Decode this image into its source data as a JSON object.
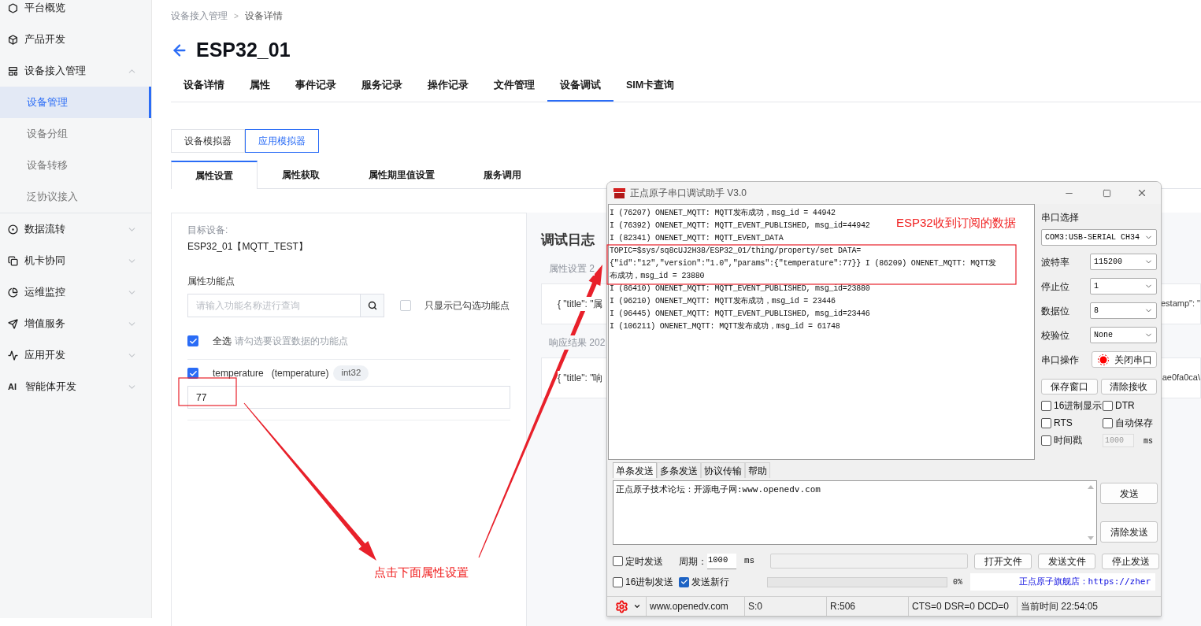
{
  "sidebar": {
    "items": [
      {
        "kind": "link",
        "label": "平台概览"
      },
      {
        "kind": "link",
        "label": "产品开发"
      },
      {
        "kind": "group",
        "label": "设备接入管理",
        "expanded": true,
        "children": [
          {
            "label": "设备管理",
            "selected": true
          },
          {
            "label": "设备分组",
            "selected": false
          },
          {
            "label": "设备转移",
            "selected": false
          },
          {
            "label": "泛协议接入",
            "selected": false
          }
        ]
      },
      {
        "kind": "group",
        "label": "数据流转",
        "expanded": false
      },
      {
        "kind": "group",
        "label": "机卡协同",
        "expanded": false
      },
      {
        "kind": "group",
        "label": "运维监控",
        "expanded": false
      },
      {
        "kind": "group",
        "label": "增值服务",
        "expanded": false
      },
      {
        "kind": "group",
        "label": "应用开发",
        "expanded": false
      },
      {
        "kind": "group",
        "label": "智能体开发",
        "expanded": false,
        "icon_text": "AI"
      }
    ]
  },
  "breadcrumb": [
    "设备接入管理",
    "设备详情"
  ],
  "breadcrumb_separator": ">",
  "title": "ESP32_01",
  "tabs": [
    {
      "label": "设备详情",
      "selected": false
    },
    {
      "label": "属性",
      "selected": false
    },
    {
      "label": "事件记录",
      "selected": false
    },
    {
      "label": "服务记录",
      "selected": false
    },
    {
      "label": "操作记录",
      "selected": false
    },
    {
      "label": "文件管理",
      "selected": false
    },
    {
      "label": "设备调试",
      "selected": true
    },
    {
      "label": "SIM卡查询",
      "selected": false
    }
  ],
  "mode_toggle": [
    {
      "label": "设备模拟器",
      "selected": false
    },
    {
      "label": "应用模拟器",
      "selected": true
    }
  ],
  "sub_tabs": [
    {
      "label": "属性设置",
      "selected": true
    },
    {
      "label": "属性获取",
      "selected": false
    },
    {
      "label": "属性期里值设置",
      "selected": false
    },
    {
      "label": "服务调用",
      "selected": false
    }
  ],
  "left_panel": {
    "target_label": "目标设备:",
    "target_value": "ESP32_01【MQTT_TEST】",
    "section_label": "属性功能点",
    "search_placeholder": "请输入功能名称进行查询",
    "filter": {
      "label": "只显示已勾选功能点",
      "checked": false
    },
    "select_all": {
      "label": "全选",
      "hint": "请勾选要设置数据的功能点",
      "checked": true
    },
    "properties": [
      {
        "name": "temperature",
        "identifier": "(temperature)",
        "type": "int32",
        "checked": true,
        "value": "77"
      }
    ]
  },
  "log_panel": {
    "title": "调试日志",
    "entries": [
      {
        "label": "属性设置 2",
        "content": "{ \"title\": \"属",
        "content_tail": "estamp\": \""
      },
      {
        "label": "响应结果 202",
        "content": "{ \"title\": \"响",
        "content_tail": "ae0fa0ca\\"
      }
    ]
  },
  "serial_window": {
    "title": "正点原子串口调试助手 V3.0",
    "log_lines": [
      "I (76207) ONENET_MQTT: MQTT发布成功，msg_id = 44942",
      "I (76392) ONENET_MQTT: MQTT_EVENT_PUBLISHED, msg_id=44942",
      "I (82341) ONENET_MQTT: MQTT_EVENT_DATA",
      "TOPIC=$sys/sq8cUJ2H38/ESP32_01/thing/property/set DATA=",
      "{\"id\":\"12\",\"version\":\"1.0\",\"params\":{\"temperature\":77}} I (86209) ONENET_MQTT: MQTT发",
      "布成功，msg_id = 23880",
      "I (86410) ONENET_MQTT: MQTT_EVENT_PUBLISHED, msg_id=23880",
      "I (96210) ONENET_MQTT: MQTT发布成功，msg_id = 23446",
      "I (96445) ONENET_MQTT: MQTT_EVENT_PUBLISHED, msg_id=23446",
      "I (106211) ONENET_MQTT: MQTT发布成功，msg_id = 61748"
    ],
    "port_label": "串口选择",
    "port": "COM3:USB-SERIAL CH34",
    "fields": [
      {
        "label": "波特率",
        "value": "115200"
      },
      {
        "label": "停止位",
        "value": "1"
      },
      {
        "label": "数据位",
        "value": "8"
      },
      {
        "label": "校验位",
        "value": "None"
      }
    ],
    "operation_label": "串口操作",
    "operation_button": "关闭串口",
    "port_open": true,
    "buttons": [
      "保存窗口",
      "清除接收"
    ],
    "options": [
      {
        "label": "16进制显示",
        "checked": false
      },
      {
        "label": "DTR",
        "checked": false
      },
      {
        "label": "RTS",
        "checked": false
      },
      {
        "label": "自动保存",
        "checked": false
      },
      {
        "label": "时间戳",
        "checked": false
      }
    ],
    "timestamp_interval": "1000",
    "timestamp_unit": "ms",
    "send_tabs": [
      {
        "label": "单条发送",
        "selected": true
      },
      {
        "label": "多条发送",
        "selected": false
      },
      {
        "label": "协议传输",
        "selected": false
      },
      {
        "label": "帮助",
        "selected": false
      }
    ],
    "send_text": "正点原子技术论坛：开源电子网:www.openedv.com",
    "send_buttons": [
      "发送",
      "清除发送"
    ],
    "timer": {
      "label": "定时发送",
      "checked": false
    },
    "period_label": "周期：",
    "period_value": "1000",
    "period_unit": "ms",
    "file_buttons": [
      "打开文件",
      "发送文件",
      "停止发送"
    ],
    "hex_send": {
      "label": "16进制发送",
      "checked": false
    },
    "send_newline": {
      "label": "发送新行",
      "checked": true
    },
    "progress": {
      "level": 0,
      "reading": "0%"
    },
    "store_link": "正点原子旗舰店：https://zher",
    "status_bar": [
      "www.openedv.com",
      "S:0",
      "R:506",
      "CTS=0 DSR=0 DCD=0",
      "当前时间 22:54:05"
    ]
  },
  "annotations": [
    {
      "text": "ESP32收到订阅的数据"
    },
    {
      "text": "点击下面属性设置"
    }
  ]
}
